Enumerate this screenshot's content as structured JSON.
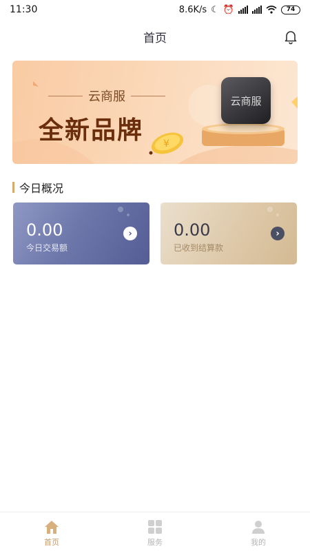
{
  "status_bar": {
    "time": "11:30",
    "network_speed": "8.6K/s",
    "battery": "74",
    "icons": [
      "moon-icon",
      "alarm-icon",
      "signal-icon",
      "signal-icon",
      "wifi-icon",
      "battery-icon"
    ]
  },
  "header": {
    "title": "首页",
    "action_icon": "bell-icon"
  },
  "banner": {
    "subtitle": "云商服",
    "title": "全新品牌",
    "logo_text": "云商服",
    "colors": {
      "bg": "#fbd9ba",
      "title": "#6a2e0c"
    }
  },
  "overview": {
    "section_title": "今日概况",
    "cards": [
      {
        "value": "0.00",
        "label": "今日交易额",
        "icon": "chevron-right-icon"
      },
      {
        "value": "0.00",
        "label": "已收到结算款",
        "icon": "chevron-right-icon"
      }
    ]
  },
  "tabbar": {
    "active_color": "#c89a63",
    "inactive_color": "#b5b5b5",
    "items": [
      {
        "label": "首页",
        "icon": "home-icon",
        "active": true
      },
      {
        "label": "服务",
        "icon": "grid-icon",
        "active": false
      },
      {
        "label": "我的",
        "icon": "user-icon",
        "active": false
      }
    ]
  }
}
